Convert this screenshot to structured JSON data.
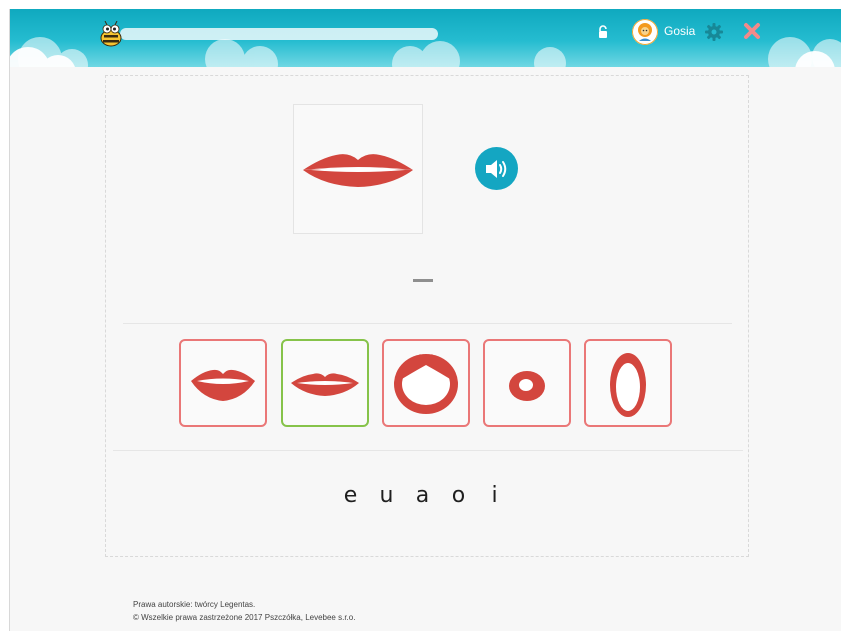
{
  "header": {
    "user_name": "Gosia",
    "progress": 0,
    "colors": {
      "bar": "#17afc4",
      "close": "#f28a8a",
      "gear": "#178897"
    },
    "icons": [
      "bee-logo-icon",
      "lock-icon",
      "avatar-icon",
      "gear-icon",
      "close-icon"
    ]
  },
  "exercise": {
    "prompt_image": "lips-e-shape",
    "sound_icon": "speaker-icon",
    "answer_placeholder": "_",
    "options": [
      {
        "name": "lips-option-1",
        "state": "default"
      },
      {
        "name": "lips-option-2",
        "state": "selected-correct"
      },
      {
        "name": "lips-option-3",
        "state": "default"
      },
      {
        "name": "lips-option-4",
        "state": "default"
      },
      {
        "name": "lips-option-5",
        "state": "default"
      }
    ],
    "letters": [
      "e",
      "u",
      "a",
      "o",
      "i"
    ],
    "colors": {
      "option_border": "#ea7777",
      "option_selected_border": "#86c34a",
      "sound_button": "#14a6c2",
      "lips": "#d3463e"
    }
  },
  "footer": {
    "line1": "Prawa autorskie: twórcy Legentas.",
    "line2": "© Wszelkie prawa zastrzeżone 2017 Pszczółka, Levebee s.r.o."
  }
}
